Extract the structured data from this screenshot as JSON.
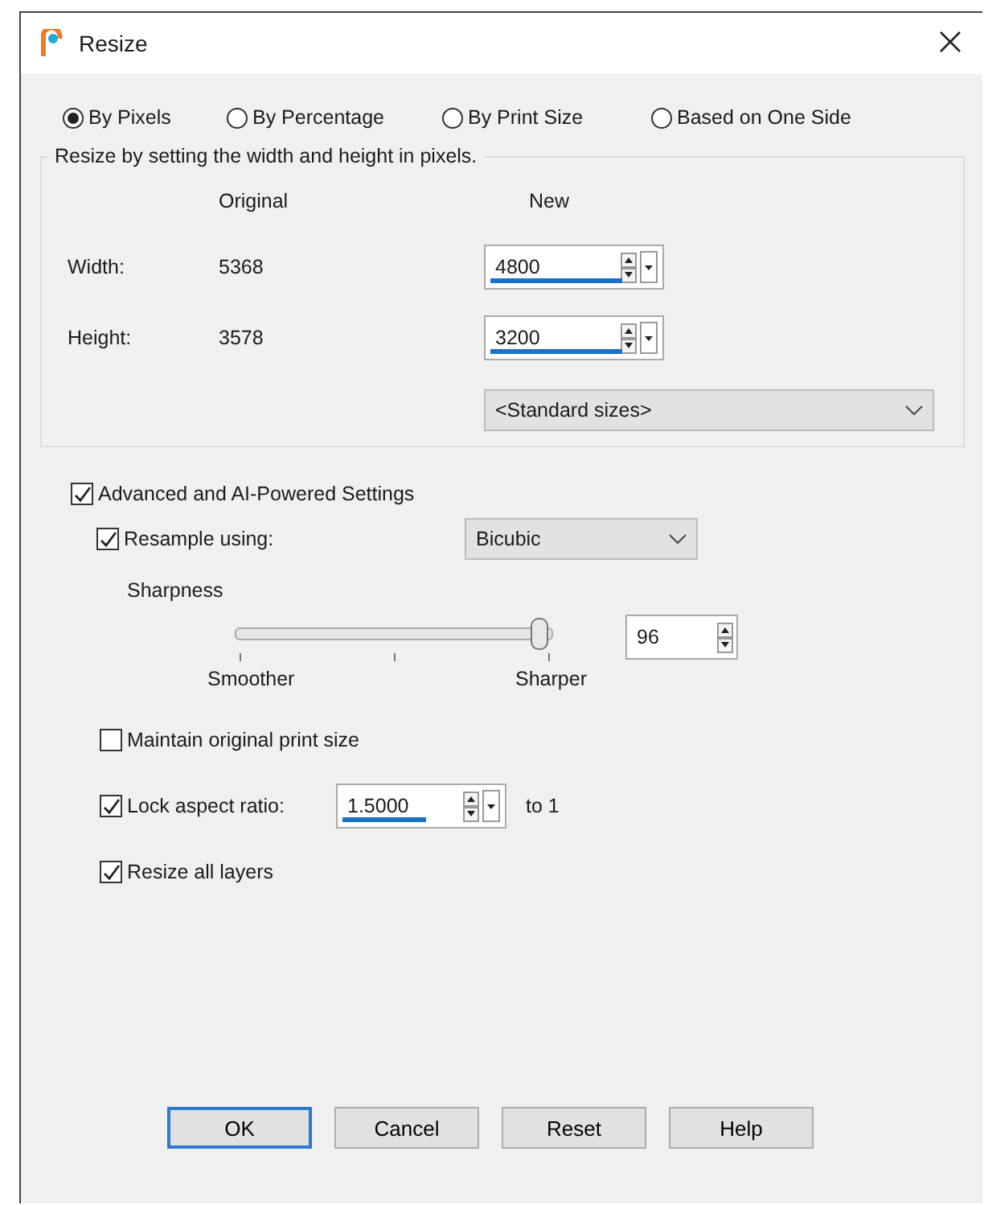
{
  "window": {
    "title": "Resize"
  },
  "modes": [
    {
      "label": "By Pixels",
      "selected": true
    },
    {
      "label": "By Percentage",
      "selected": false
    },
    {
      "label": "By Print Size",
      "selected": false
    },
    {
      "label": "Based on One Side",
      "selected": false
    }
  ],
  "group": {
    "legend": "Resize by setting the width and height in pixels.",
    "col_original": "Original",
    "col_new": "New",
    "rows": [
      {
        "label": "Width:",
        "original": "5368",
        "value": "4800"
      },
      {
        "label": "Height:",
        "original": "3578",
        "value": "3200"
      }
    ],
    "standard_sizes": "<Standard sizes>"
  },
  "advanced": {
    "label": "Advanced and AI-Powered Settings",
    "checked": true
  },
  "resample": {
    "label": "Resample using:",
    "checked": true,
    "method": "Bicubic"
  },
  "sharpness": {
    "label": "Sharpness",
    "level": 0.96,
    "min_label": "Smoother",
    "max_label": "Sharper",
    "value": "96"
  },
  "maintain": {
    "label": "Maintain original print size",
    "checked": false
  },
  "lock": {
    "label": "Lock aspect ratio:",
    "checked": true,
    "value": "1.5000",
    "suffix": "to 1"
  },
  "layers": {
    "label": "Resize all layers",
    "checked": true
  },
  "buttons": [
    {
      "label": "OK",
      "default": true
    },
    {
      "label": "Cancel",
      "default": false
    },
    {
      "label": "Reset",
      "default": false
    },
    {
      "label": "Help",
      "default": false
    }
  ]
}
